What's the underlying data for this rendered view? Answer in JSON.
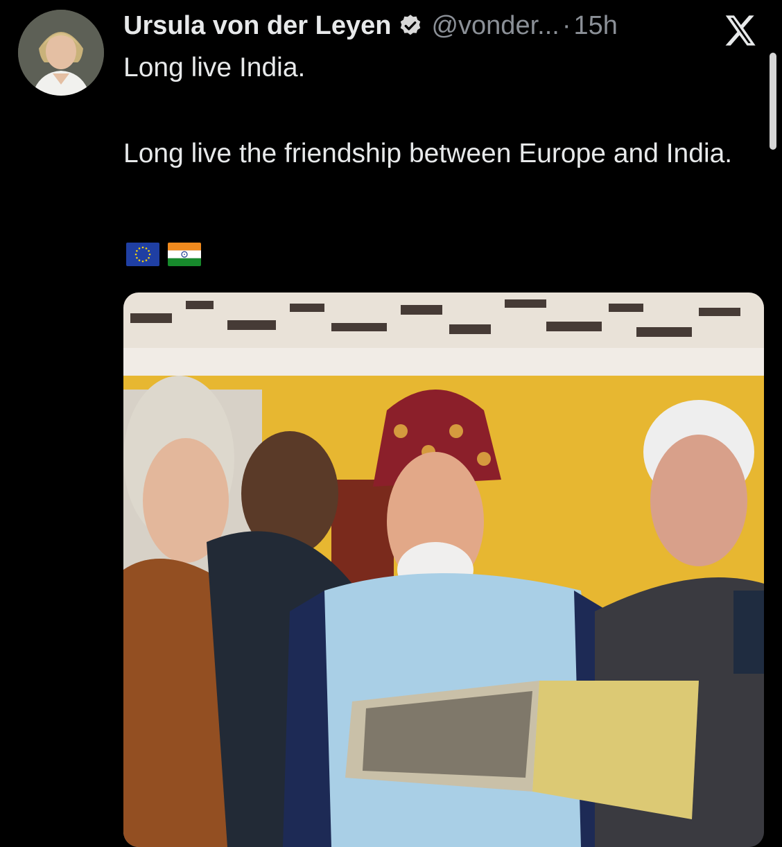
{
  "tweet": {
    "author_name": "Ursula von der Leyen",
    "handle": "@vonder...",
    "separator": "·",
    "time": "15h",
    "text_lines": [
      "Long live India.",
      "Long live the friendship between Europe and India."
    ],
    "flags": [
      "eu-flag-icon",
      "india-flag-icon"
    ]
  },
  "icons": {
    "verified": "verified-badge-icon",
    "close": "x-logo-icon"
  },
  "colors": {
    "background": "#000000",
    "text": "#e7e9ea",
    "secondary_text": "#8b9097"
  }
}
